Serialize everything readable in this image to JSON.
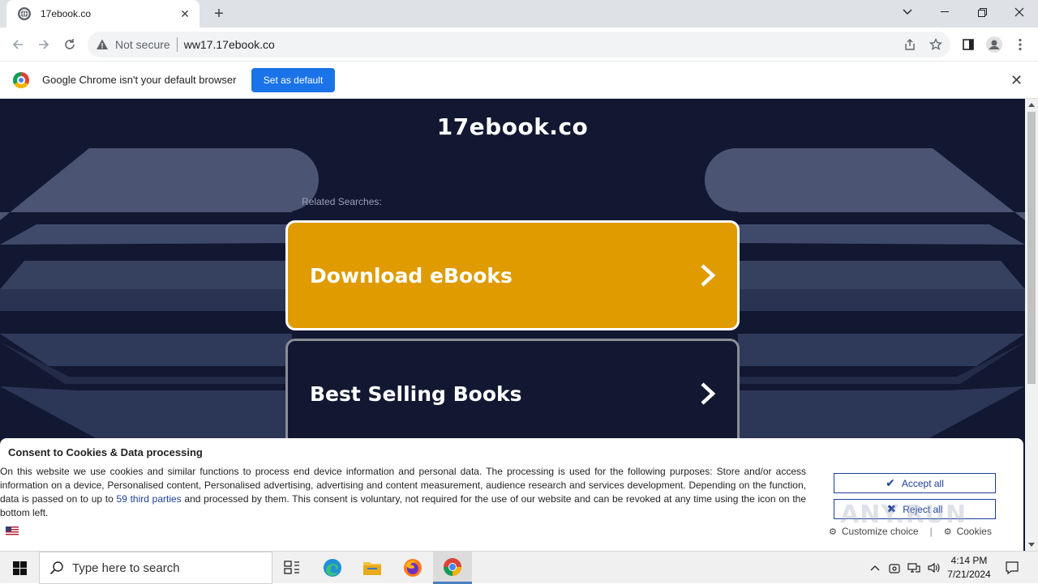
{
  "browser": {
    "tab_title": "17ebook.co",
    "new_tab_label": "+",
    "security_label": "Not secure",
    "url": "ww17.17ebook.co",
    "infobar_text": "Google Chrome isn't your default browser",
    "set_default_label": "Set as default"
  },
  "page": {
    "site_title": "17ebook.co",
    "related_label": "Related Searches:",
    "buttons": [
      {
        "label": "Download eBooks",
        "color": "#df9b00"
      },
      {
        "label": "Best Selling Books",
        "color": "#121831"
      }
    ],
    "accent_color": "#1b3f9c"
  },
  "consent": {
    "title": "Consent to Cookies & Data processing",
    "body_part1": "On this website we use cookies and similar functions to process end device information and personal data. The processing is used for the following purposes: Store and/or access information on a device, Personalised content, Personalised advertising, advertising and content measurement, audience research and services development. Depending on the function, data is passed on to up to ",
    "body_link": "59 third parties",
    "body_part2": " and processed by them. This consent is voluntary, not required for the use of our website and can be revoked at any time using the icon on the bottom left.",
    "accept_label": "Accept all",
    "reject_label": "Reject all",
    "customize_label": "Customize choice",
    "cookies_label": "Cookies",
    "divider": "|",
    "watermark": "ANY.RUN"
  },
  "taskbar": {
    "search_placeholder": "Type here to search",
    "time": "4:14 PM",
    "date": "7/21/2024"
  }
}
